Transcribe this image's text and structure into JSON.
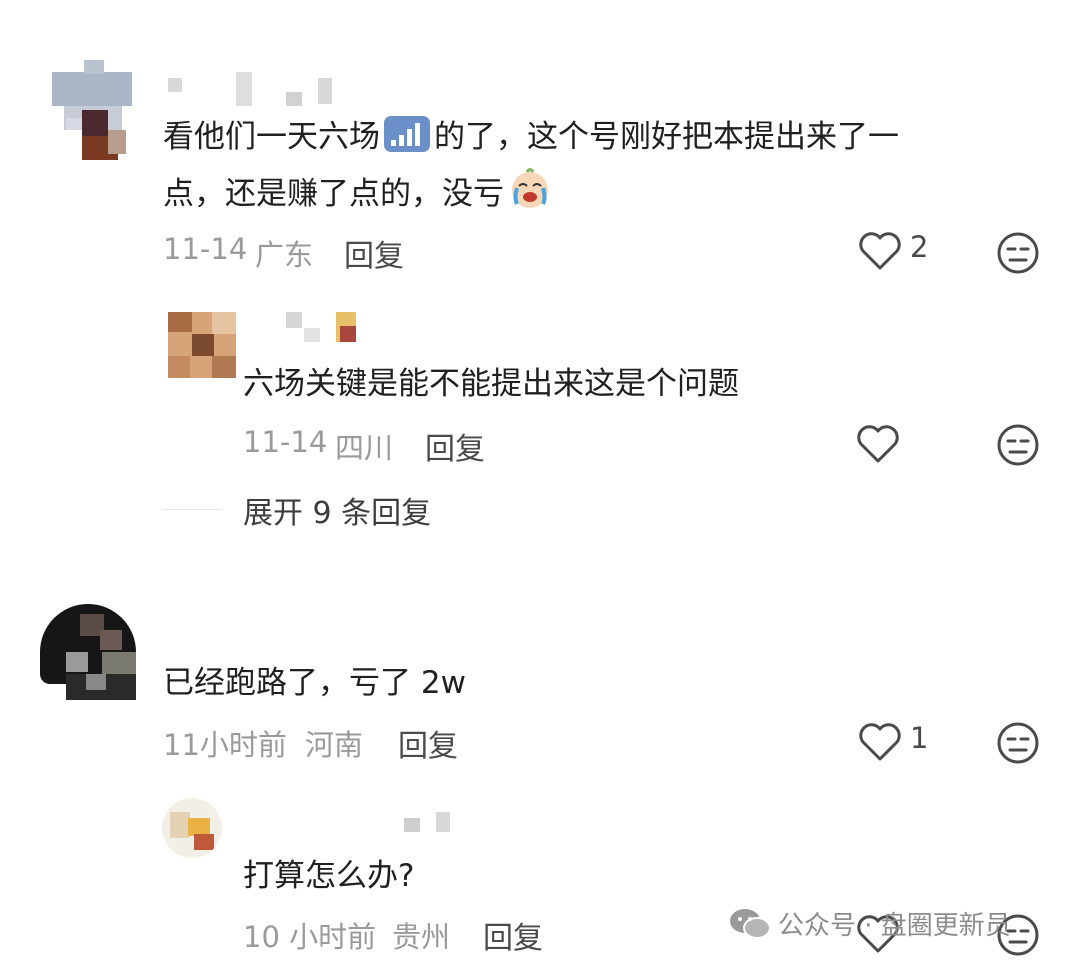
{
  "comments": [
    {
      "text_line1_a": "看他们一天六场",
      "text_line1_b": "的了，这个号刚好把本提出来了一",
      "text_line2_a": "点，还是赚了点的，没亏",
      "emoji1": "signal-bars-emoji",
      "emoji2": "crying-face-emoji",
      "date": "11-14",
      "location": "广东",
      "reply_label": "回复",
      "likes": "2",
      "reply": {
        "text": "六场关键是能不能提出来这是个问题",
        "date": "11-14",
        "location": "四川",
        "reply_label": "回复"
      },
      "expand_label": "展开 9 条回复"
    },
    {
      "text": "已经跑路了，亏了 2w",
      "date": "11小时前",
      "location": "河南",
      "reply_label": "回复",
      "likes": "1",
      "reply": {
        "text": "打算怎么办?",
        "date": "10 小时前",
        "location": "贵州",
        "reply_label": "回复"
      }
    }
  ],
  "watermark": "公众号 · 盘圈更新员",
  "colors": {
    "text": "#202020",
    "meta": "#9a9a9a",
    "icon": "#4a4a4a",
    "divider": "#e6e6e6"
  }
}
